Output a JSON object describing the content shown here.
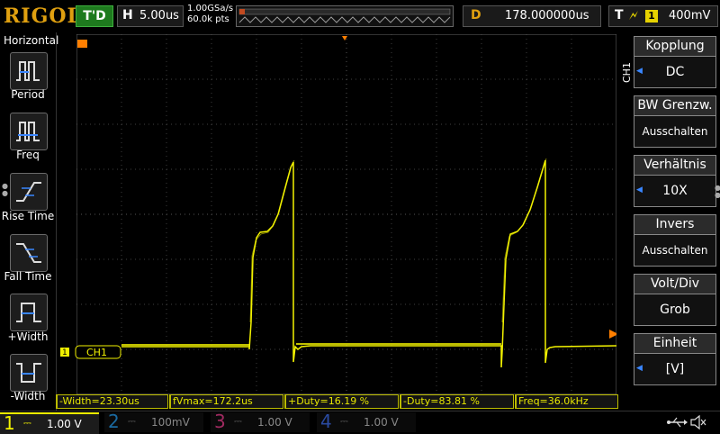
{
  "brand": "RIGOL",
  "top": {
    "trigger_status": "T'D",
    "horizontal_key": "H",
    "timebase": "5.00us",
    "sample_rate": "1.00GSa/s",
    "mem_depth": "60.0k pts",
    "delay_key": "D",
    "delay": "178.000000us",
    "trigger_key": "T",
    "trigger_source": "1",
    "trigger_level": "400mV"
  },
  "left_menu": {
    "title": "Horizontal",
    "items": [
      {
        "label": "Period",
        "icon": "period-icon"
      },
      {
        "label": "Freq",
        "icon": "frequency-icon"
      },
      {
        "label": "Rise Time",
        "icon": "rise-time-icon"
      },
      {
        "label": "Fall Time",
        "icon": "fall-time-icon"
      },
      {
        "label": "+Width",
        "icon": "positive-width-icon"
      },
      {
        "label": "-Width",
        "icon": "negative-width-icon"
      }
    ]
  },
  "right_menu": {
    "channel_label": "CH1",
    "items": [
      {
        "title": "Kopplung",
        "value": "DC"
      },
      {
        "title": "BW Grenzw.",
        "value": "Ausschalten"
      },
      {
        "title": "Verhältnis",
        "value": "10X"
      },
      {
        "title": "Invers",
        "value": "Ausschalten"
      },
      {
        "title": "Volt/Div",
        "value": "Grob"
      },
      {
        "title": "Einheit",
        "value": "[V]"
      }
    ]
  },
  "screen": {
    "channel_marker_label": "CH1",
    "trace_color": "#f2f200",
    "grid_color": "#555555"
  },
  "measurements": [
    "-Width=23.30us",
    "fVmax=172.2us",
    "+Duty=16.19 %",
    "-Duty=83.81 %",
    "Freq=36.0kHz"
  ],
  "bottom": {
    "channels": [
      {
        "num": "1",
        "volts": "1.00 V",
        "color": "#f2f200",
        "active": true
      },
      {
        "num": "2",
        "volts": "100mV",
        "color": "#1ab0ff",
        "active": false
      },
      {
        "num": "3",
        "volts": "1.00 V",
        "color": "#ff3a8c",
        "active": false
      },
      {
        "num": "4",
        "volts": "1.00 V",
        "color": "#3a6aff",
        "active": false
      }
    ]
  }
}
